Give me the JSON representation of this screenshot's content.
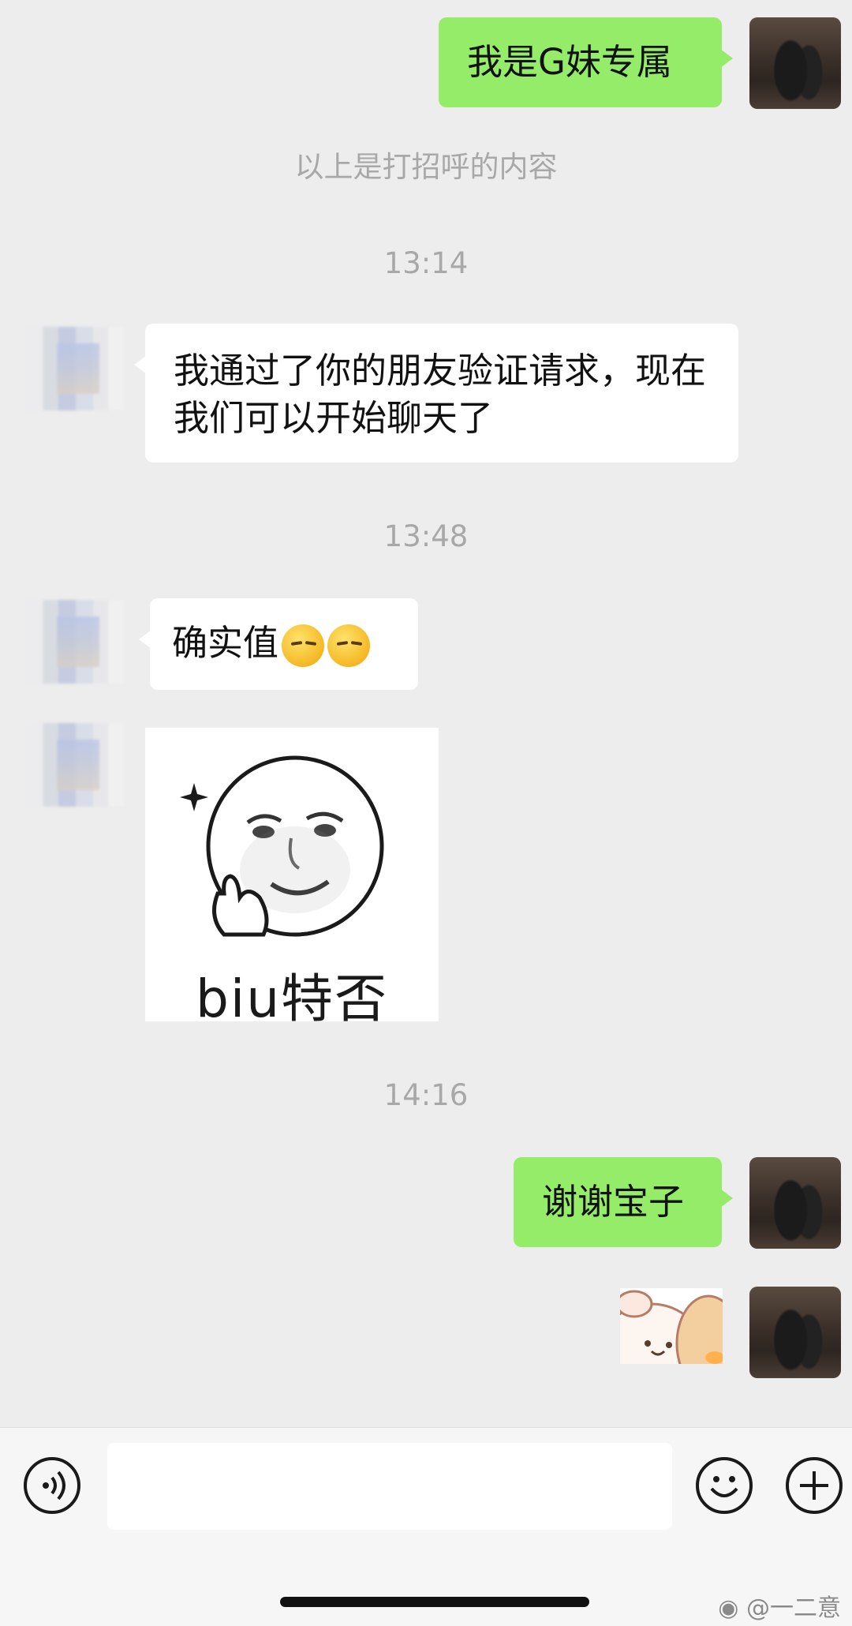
{
  "messages": {
    "msg1": "我是G妹专属",
    "greeting_note": "以上是打招呼的内容",
    "time1": "13:14",
    "msg2": "我通过了你的朋友验证请求，现在我们可以开始聊天了",
    "time2": "13:48",
    "msg3": "确实值",
    "msg3_emoji": [
      "thinking-face-emoji",
      "thinking-face-emoji"
    ],
    "sticker_caption": "biu特否",
    "time3": "14:16",
    "msg4": "谢谢宝子"
  },
  "input_bar": {
    "voice_icon": "voice-icon",
    "emoji_icon": "emoji-icon",
    "plus_icon": "plus-icon"
  },
  "watermark": "@一二意",
  "colors": {
    "background": "#ededed",
    "self_bubble": "#95ec69",
    "other_bubble": "#ffffff",
    "timestamp": "#a8a8a8"
  }
}
